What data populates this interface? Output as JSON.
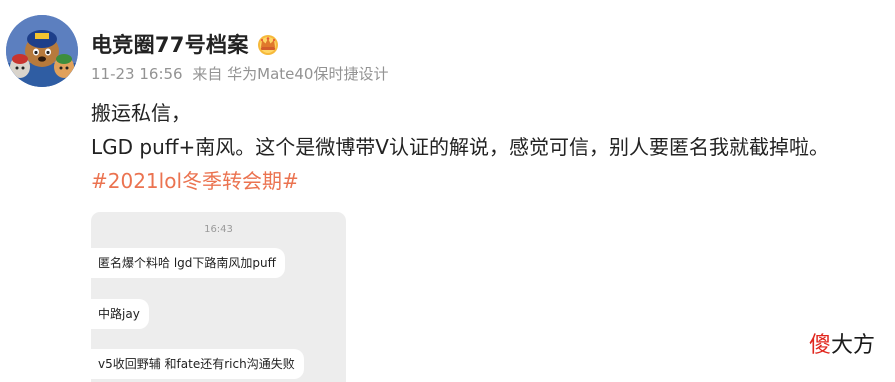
{
  "user": {
    "name": "电竞圈77号档案",
    "badge_icon": "crown-badge-icon"
  },
  "meta": {
    "time": "11-23 16:56",
    "source": "来自 华为Mate40保时捷设计"
  },
  "content": {
    "line1": "搬运私信，",
    "line2": "LGD puff+南风。这个是微博带V认证的解说，感觉可信，别人要匿名我就截掉啦。",
    "hashtag": "#2021lol冬季转会期#"
  },
  "chat_image": {
    "time": "16:43",
    "messages": [
      "匿名爆个料哈  lgd下路南风加puff",
      "中路jay",
      "v5收回野辅  和fate还有rich沟通失败"
    ]
  },
  "watermark": {
    "red": "傻",
    "black": "大方"
  },
  "colors": {
    "hashtag": "#eb7350",
    "meta": "#939393",
    "chat_bg": "#ededed"
  }
}
